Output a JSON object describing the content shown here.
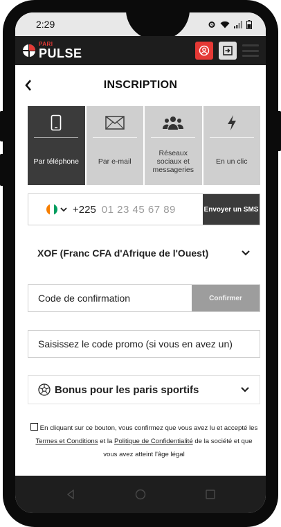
{
  "status_bar": {
    "time": "2:29",
    "icons": [
      "alarm-icon",
      "wifi-icon",
      "signal-icon",
      "battery-icon"
    ]
  },
  "header": {
    "logo_small": "PARI",
    "logo_main": "PULSE",
    "actions": [
      "register-icon",
      "login-icon",
      "menu-icon"
    ],
    "accent_color": "#e53935"
  },
  "page": {
    "title": "INSCRIPTION",
    "back_icon": "chevron-left-icon"
  },
  "tabs": [
    {
      "label": "Par téléphone",
      "icon": "phone-icon",
      "active": true
    },
    {
      "label": "Par e-mail",
      "icon": "envelope-icon",
      "active": false
    },
    {
      "label": "Réseaux sociaux et messageries",
      "icon": "users-icon",
      "active": false
    },
    {
      "label": "En un clic",
      "icon": "lightning-icon",
      "active": false
    }
  ],
  "phone": {
    "dial_code": "+225",
    "placeholder": "01 23 45 67 89",
    "send_sms_label": "Envoyer un SMS",
    "flag_colors": [
      "#f77f00",
      "#ffffff",
      "#009e60"
    ]
  },
  "currency": {
    "value": "XOF (Franc CFA d'Afrique de l'Ouest)"
  },
  "confirmation": {
    "placeholder": "Code de confirmation",
    "button_label": "Confirmer"
  },
  "promo": {
    "placeholder": "Saisissez le code promo (si vous en avez un)"
  },
  "bonus": {
    "label": "Bonus pour les paris sportifs",
    "icon": "soccer-ball-icon"
  },
  "consent": {
    "text_1": "En cliquant sur ce bouton, vous confirmez que vous avez lu et accepté les",
    "terms_link": "Termes et Conditions",
    "text_2": "et la",
    "privacy_link": "Politique de Confidentialité",
    "text_3": "de la société et que vous avez atteint l'âge légal"
  },
  "nav_bar": {
    "buttons": [
      "back-triangle-icon",
      "home-circle-icon",
      "recents-square-icon"
    ]
  }
}
